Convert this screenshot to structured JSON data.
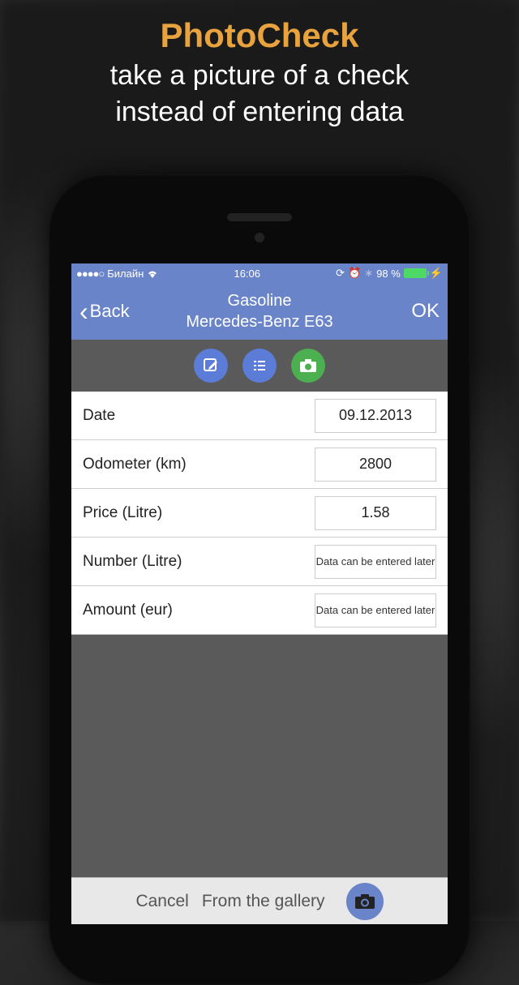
{
  "promo": {
    "title": "PhotoCheck",
    "line1": "take a picture of a check",
    "line2": "instead of entering data"
  },
  "status": {
    "carrier": "Билайн",
    "time": "16:06",
    "battery": "98 %"
  },
  "nav": {
    "back": "Back",
    "title_line1": "Gasoline",
    "title_line2": "Mercedes-Benz E63",
    "ok": "OK"
  },
  "form": {
    "rows": [
      {
        "label": "Date",
        "value": "09.12.2013",
        "placeholder": ""
      },
      {
        "label": "Odometer (km)",
        "value": "2800",
        "placeholder": ""
      },
      {
        "label": "Price (Litre)",
        "value": "1.58",
        "placeholder": ""
      },
      {
        "label": "Number (Litre)",
        "value": "",
        "placeholder": "Data can be entered later"
      },
      {
        "label": "Amount (eur)",
        "value": "",
        "placeholder": "Data can be entered later"
      }
    ]
  },
  "bottom": {
    "cancel": "Cancel",
    "gallery": "From the gallery"
  }
}
